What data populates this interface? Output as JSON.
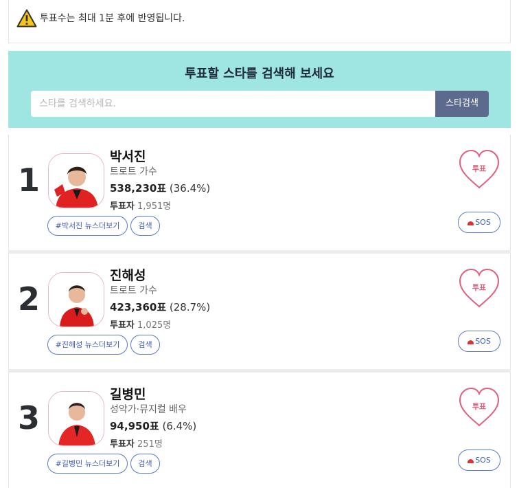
{
  "notice": {
    "text": "투표수는 최대 1분 후에 반영됩니다."
  },
  "search": {
    "title": "투표할 스타를 검색해 보세요",
    "placeholder": "스타를 검색하세요.",
    "button": "스타검색"
  },
  "ranks": [
    {
      "rank": "1",
      "name": "박서진",
      "job": "트로트 가수",
      "votes": "538,230표",
      "percent": "(36.4%)",
      "voter_label": "투표자",
      "voters": "1,951명",
      "news_tag": "#박서진 뉴스더보기",
      "search_tag": "검색",
      "vote_button": "투표",
      "sos": "SOS"
    },
    {
      "rank": "2",
      "name": "진해성",
      "job": "트로트 가수",
      "votes": "423,360표",
      "percent": "(28.7%)",
      "voter_label": "투표자",
      "voters": "1,025명",
      "news_tag": "#진해성 뉴스더보기",
      "search_tag": "검색",
      "vote_button": "투표",
      "sos": "SOS"
    },
    {
      "rank": "3",
      "name": "길병민",
      "job": "성악가·뮤지컬 배우",
      "votes": "94,950표",
      "percent": "(6.4%)",
      "voter_label": "투표자",
      "voters": "251명",
      "news_tag": "#길병민 뉴스더보기",
      "search_tag": "검색",
      "vote_button": "투표",
      "sos": "SOS"
    }
  ],
  "colors": {
    "search_bg": "#9fe6e2",
    "search_button": "#5c6a8d",
    "heart": "#e0607e",
    "tag_border": "#5a79c6",
    "rank_digit": "#2b2f33"
  }
}
